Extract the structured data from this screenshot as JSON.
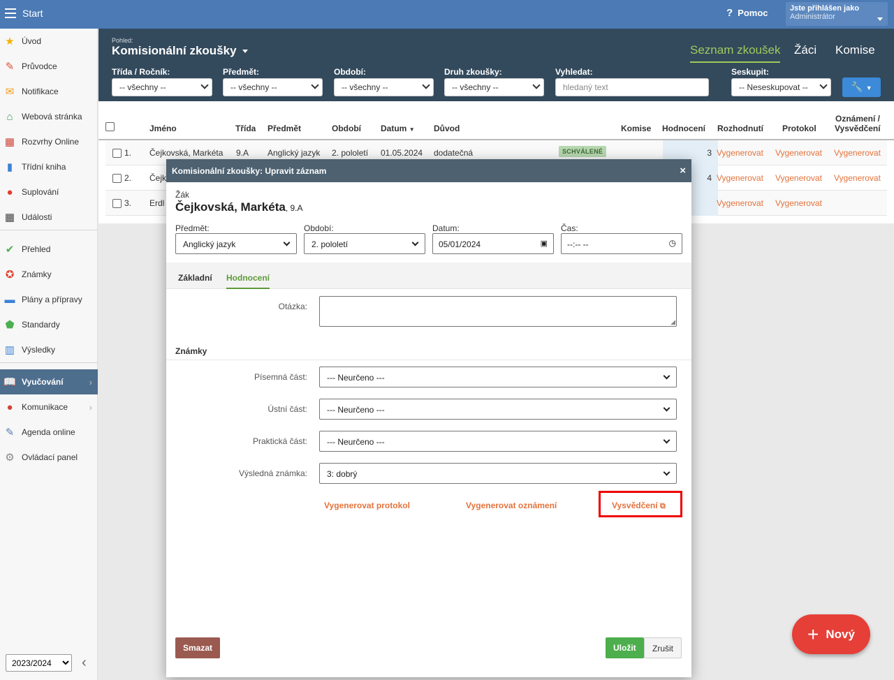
{
  "topbar": {
    "start_label": "Start",
    "help_label": "Pomoc",
    "help_glyph": "?",
    "user_line1": "Jste přihlášen jako",
    "user_line2": "Administrátor"
  },
  "sidebar": {
    "items": [
      {
        "label": "Úvod",
        "icon": "star-icon",
        "glyph": "★",
        "color": "#f0b400"
      },
      {
        "label": "Průvodce",
        "icon": "magic-wand-icon",
        "glyph": "✎",
        "color": "#e0503a"
      },
      {
        "label": "Notifikace",
        "icon": "envelope-icon",
        "glyph": "✉",
        "color": "#f0a020"
      },
      {
        "label": "Webová stránka",
        "icon": "home-icon",
        "glyph": "⌂",
        "color": "#3a9a5a"
      },
      {
        "label": "Rozvrhy Online",
        "icon": "calendar-grid-icon",
        "glyph": "▦",
        "color": "#d0453a"
      },
      {
        "label": "Třídní kniha",
        "icon": "book-icon",
        "glyph": "▮",
        "color": "#3b82d6"
      },
      {
        "label": "Suplování",
        "icon": "person-icon",
        "glyph": "●",
        "color": "#e04030"
      },
      {
        "label": "Události",
        "icon": "calendar-icon",
        "glyph": "▦",
        "color": "#444"
      },
      {
        "label": "Přehled",
        "icon": "check-circle-icon",
        "glyph": "✔",
        "color": "#4caf50"
      },
      {
        "label": "Známky",
        "icon": "grade-icon",
        "glyph": "✪",
        "color": "#e04030"
      },
      {
        "label": "Plány a přípravy",
        "icon": "briefcase-icon",
        "glyph": "▬",
        "color": "#3b82d6"
      },
      {
        "label": "Standardy",
        "icon": "shield-icon",
        "glyph": "⬟",
        "color": "#4caf50"
      },
      {
        "label": "Výsledky",
        "icon": "bar-chart-icon",
        "glyph": "▥",
        "color": "#3b82d6"
      },
      {
        "label": "Vyučování",
        "icon": "open-book-icon",
        "glyph": "📖",
        "color": "#ffffff"
      },
      {
        "label": "Komunikace",
        "icon": "chat-icon",
        "glyph": "●",
        "color": "#d0453a"
      },
      {
        "label": "Agenda online",
        "icon": "pencil-icon",
        "glyph": "✎",
        "color": "#5a7fb0"
      },
      {
        "label": "Ovládací panel",
        "icon": "gear-icon",
        "glyph": "⚙",
        "color": "#888"
      }
    ],
    "year": "2023/2024"
  },
  "header": {
    "pohled_label": "Pohled:",
    "title": "Komisionální zkoušky",
    "tabs": [
      "Seznam zkoušek",
      "Žáci",
      "Komise"
    ],
    "filters": [
      {
        "label": "Třída / Ročník:",
        "value": "-- všechny --"
      },
      {
        "label": "Předmět:",
        "value": "-- všechny --"
      },
      {
        "label": "Období:",
        "value": "-- všechny --"
      },
      {
        "label": "Druh zkoušky:",
        "value": "-- všechny --"
      }
    ],
    "search_label": "Vyhledat:",
    "search_placeholder": "hledaný text",
    "group_label": "Seskupit:",
    "group_value": "-- Neseskupovat --"
  },
  "grid": {
    "columns": [
      "Jméno",
      "Třída",
      "Předmět",
      "Období",
      "Datum",
      "Důvod",
      "Komise",
      "Hodnocení",
      "Rozhodnutí",
      "Protokol",
      "Oznámení /",
      "Vysvědčení"
    ],
    "rows": [
      {
        "num": "1.",
        "name": "Čejkovská, Markéta",
        "class": "9.A",
        "subject": "Anglický jazyk",
        "period": "2. pololetí",
        "date": "01.05.2024",
        "reason": "dodatečná",
        "badge": "SCHVÁLENÉ",
        "grade": "3",
        "rozh": "Vygenerovat",
        "prot": "Vygenerovat",
        "ozn": "Vygenerovat"
      },
      {
        "num": "2.",
        "name": "Čejk",
        "grade": "4",
        "rozh": "Vygenerovat",
        "prot": "Vygenerovat",
        "ozn": "Vygenerovat"
      },
      {
        "num": "3.",
        "name": "Erdl",
        "rozh": "Vygenerovat",
        "prot": "Vygenerovat"
      }
    ]
  },
  "modal": {
    "title": "Komisionální zkoušky: Upravit záznam",
    "close": "×",
    "student_label": "Žák",
    "student_name": "Čejkovská, Markéta",
    "student_class": ", 9.A",
    "subject_label": "Předmět:",
    "subject_value": "Anglický jazyk",
    "period_label": "Období:",
    "period_value": "2. pololetí",
    "date_label": "Datum:",
    "date_value": "05/01/2024",
    "time_label": "Čas:",
    "time_value": "--:-- --",
    "tabs": [
      "Základní",
      "Hodnocení"
    ],
    "question_label": "Otázka:",
    "grades_heading": "Známky",
    "written_label": "Písemná část:",
    "written_value": "--- Neurčeno ---",
    "oral_label": "Ústní část:",
    "oral_value": "--- Neurčeno ---",
    "practical_label": "Praktická část:",
    "practical_value": "--- Neurčeno ---",
    "final_label": "Výsledná známka:",
    "final_value": "3: dobrý",
    "gen_protocol": "Vygenerovat protokol",
    "gen_notice": "Vygenerovat oznámení",
    "certificate": "Vysvědčení",
    "delete": "Smazat",
    "save": "Uložit",
    "cancel": "Zrušit"
  },
  "fab": {
    "label": "Nový",
    "glyph": "+"
  },
  "colors": {
    "accent_green": "#5d9a3a",
    "link_orange": "#e3733c",
    "topbar": "#4b7ab4",
    "header": "#33495c",
    "fab": "#e53f38",
    "delete": "#9a5a50"
  }
}
